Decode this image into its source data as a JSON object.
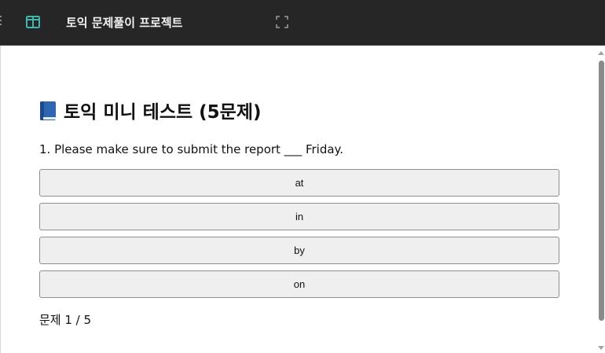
{
  "header": {
    "title": "토익 문제풀이 프로젝트",
    "sidebar_toggle_icon": "panel-icon",
    "fullscreen_icon": "fullscreen-icon",
    "accent_color": "#3fb9b0",
    "background_color": "#262626"
  },
  "quiz": {
    "title_icon": "blue-book-icon",
    "title": "토익 미니 테스트 (5문제)",
    "question": "1. Please make sure to submit the report ___ Friday.",
    "options": [
      "at",
      "in",
      "by",
      "on"
    ],
    "progress": "문제 1 / 5",
    "current_question": 1,
    "total_questions": 5
  }
}
